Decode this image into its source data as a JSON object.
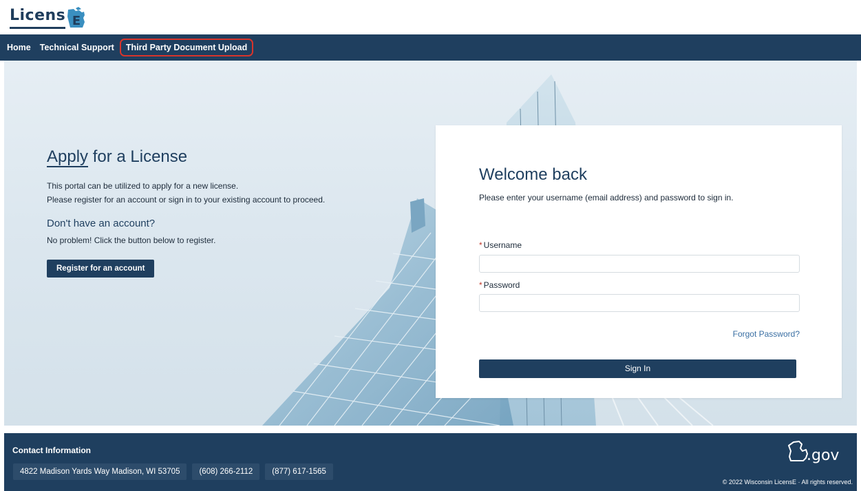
{
  "logo": {
    "text": "Licens",
    "mark": "E"
  },
  "nav": [
    {
      "label": "Home"
    },
    {
      "label": "Technical Support"
    },
    {
      "label": "Third Party Document Upload"
    }
  ],
  "apply": {
    "title_part1": "Apply",
    "title_part2": " for a License",
    "line1": "This portal can be utilized to apply for a new license.",
    "line2": "Please register for an account or sign in to your existing account to proceed.",
    "subheading": "Don't have an account?",
    "subtext": "No problem! Click the button below to register.",
    "register_label": "Register for an account"
  },
  "login": {
    "title": "Welcome back",
    "intro": "Please enter your username (email address) and password to sign in.",
    "username_label": "Username",
    "username_value": "",
    "password_label": "Password",
    "password_value": "",
    "required_mark": "*",
    "forgot_label": "Forgot Password?",
    "signin_label": "Sign In"
  },
  "footer": {
    "contact_title": "Contact Information",
    "address": "4822 Madison Yards Way Madison, WI 53705",
    "phone1": "(608) 266-2112",
    "phone2": "(877) 617-1565",
    "gov_text": ".gov",
    "copyright": "© 2022 Wisconsin LicensE · All rights reserved."
  },
  "colors": {
    "brand_navy": "#1f3f5f",
    "link_blue": "#3a6fa3",
    "required_red": "#c0392b",
    "highlight_red": "#d9342b"
  },
  "icons": {
    "logo": "wisconsin-state-logo-icon",
    "gov": "wisconsin-gov-icon"
  }
}
